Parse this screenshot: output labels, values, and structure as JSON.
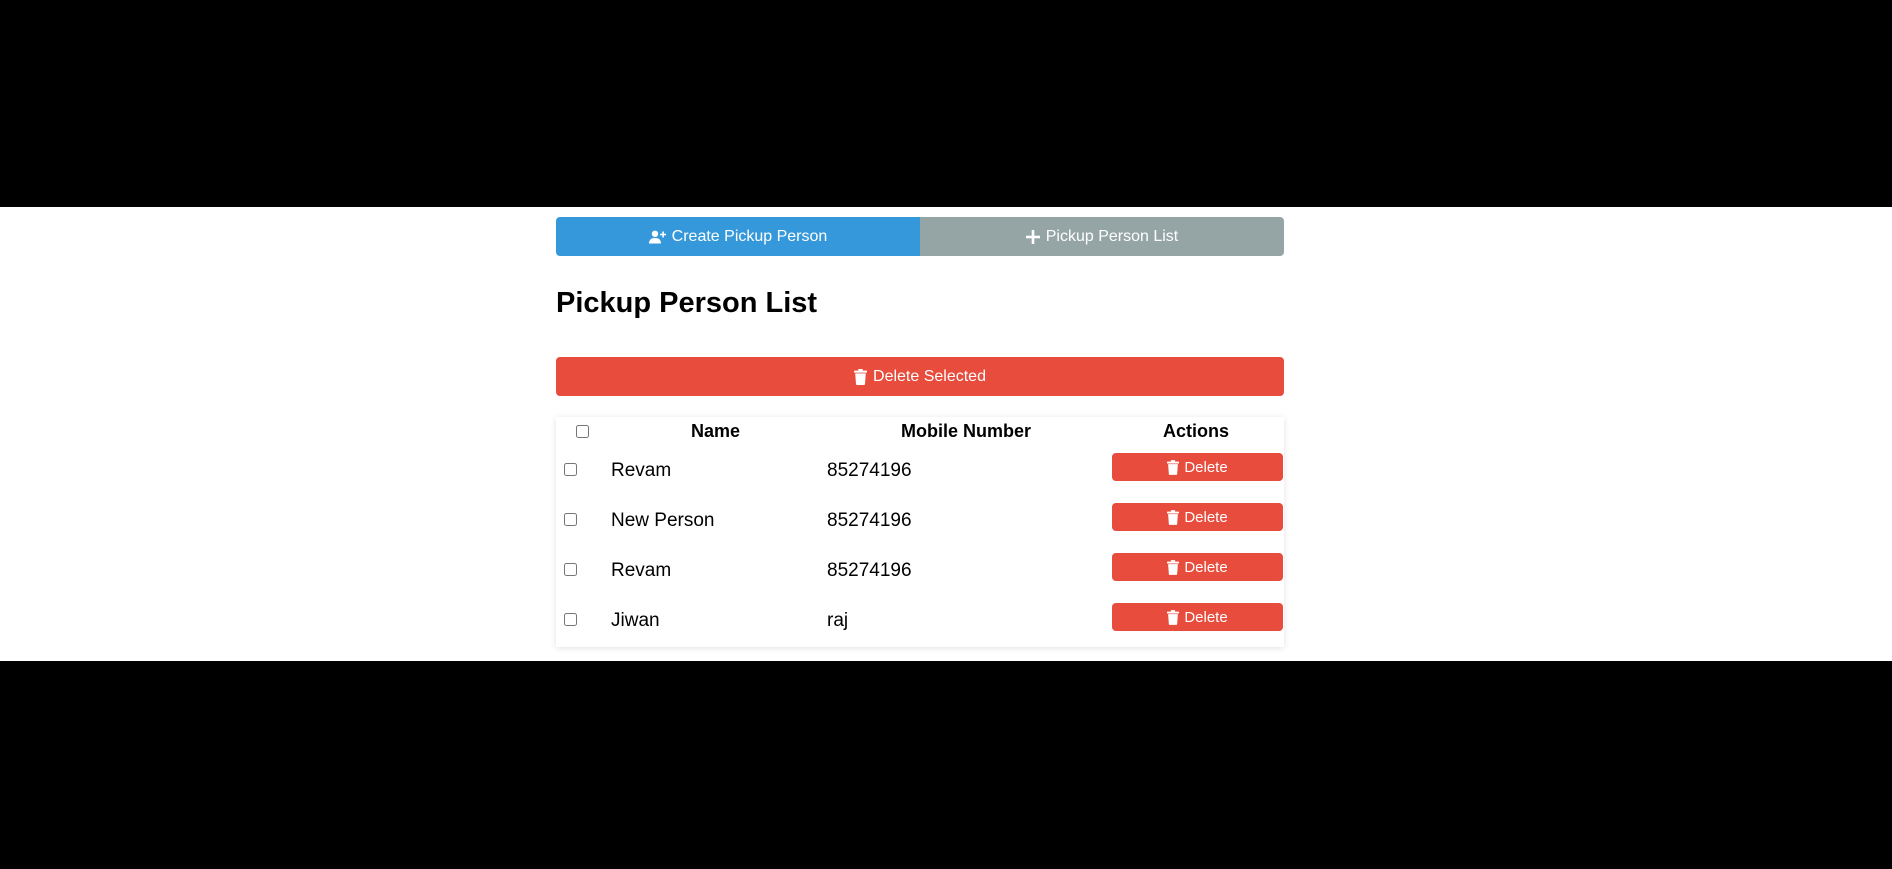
{
  "tabs": {
    "create_label": "Create Pickup Person",
    "create_icon": "user-plus-icon",
    "list_label": "Pickup Person List",
    "list_icon": "plus-icon"
  },
  "page_title": "Pickup Person List",
  "delete_selected_label": "Delete Selected",
  "table": {
    "columns": {
      "name": "Name",
      "mobile": "Mobile Number",
      "actions": "Actions"
    },
    "rows": [
      {
        "name": "Revam",
        "mobile": "85274196",
        "action": "Delete"
      },
      {
        "name": "New Person",
        "mobile": "85274196",
        "action": "Delete"
      },
      {
        "name": "Revam",
        "mobile": "85274196",
        "action": "Delete"
      },
      {
        "name": "Jiwan",
        "mobile": "raj",
        "action": "Delete"
      }
    ]
  },
  "colors": {
    "primary": "#3498db",
    "secondary": "#95a5a6",
    "danger": "#e74c3c"
  }
}
